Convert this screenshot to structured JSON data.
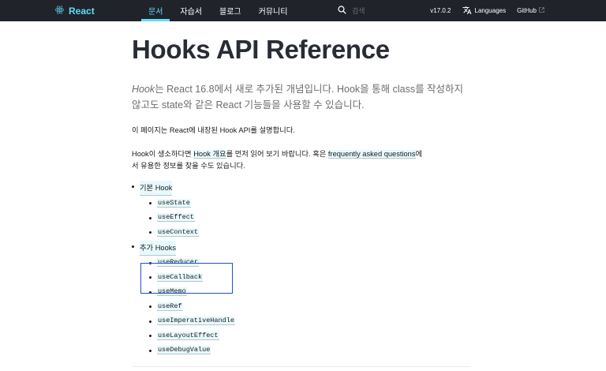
{
  "header": {
    "brand": "React",
    "nav": [
      "문서",
      "자습서",
      "블로그",
      "커뮤니티"
    ],
    "active_nav": 0,
    "search_placeholder": "검색",
    "version": "v17.0.2",
    "languages": "Languages",
    "github": "GitHub"
  },
  "page": {
    "title": "Hooks API Reference",
    "intro": {
      "hook_em": "Hook",
      "rest": "는 React 16.8에서 새로 추가된 개념입니다. Hook을 통해 class를 작성하지 않고도 state와 같은 React 기능들을 사용할 수 있습니다."
    },
    "para1": "이 페이지는 React에 내장된 Hook API를 설명합니다.",
    "para2": {
      "p1": "Hook이 생소하다면 ",
      "link1": "Hook 개요",
      "p2": "를 먼저 읽어 보기 바랍니다. 혹은 ",
      "link2": "frequently asked questions",
      "p3": "에서 유용한 정보를 찾을 수도 있습니다."
    },
    "toc": {
      "basic_label": "기본 Hook",
      "basic": [
        "useState",
        "useEffect",
        "useContext"
      ],
      "additional_label": "추가 Hooks",
      "additional": [
        "useReducer",
        "useCallback",
        "useMemo",
        "useRef",
        "useImperativeHandle",
        "useLayoutEffect",
        "useDebugValue"
      ]
    }
  },
  "colors": {
    "nav_bg": "#20232a",
    "accent": "#61dafb",
    "highlight_box": "#1f4fd1"
  },
  "icons": {
    "brand": "react-logo-icon",
    "search": "search-icon",
    "languages": "translate-icon",
    "github": "external-link-icon"
  }
}
